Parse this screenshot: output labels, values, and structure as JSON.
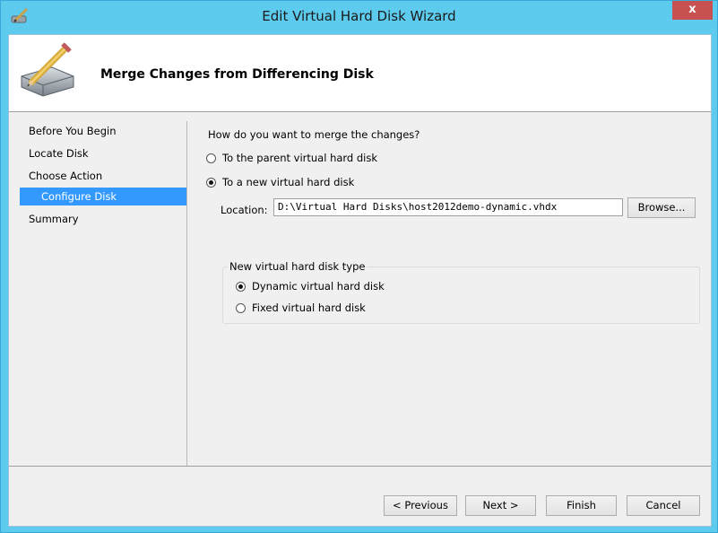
{
  "window": {
    "title": "Edit Virtual Hard Disk Wizard",
    "close_label": "x",
    "accent_color": "#5ccbee"
  },
  "header": {
    "title": "Merge Changes from Differencing Disk",
    "icon": "hard-disk-pencil-icon"
  },
  "nav": {
    "items": [
      {
        "label": "Before You Begin",
        "selected": false
      },
      {
        "label": "Locate Disk",
        "selected": false
      },
      {
        "label": "Choose Action",
        "selected": false
      },
      {
        "label": "Configure Disk",
        "selected": true
      },
      {
        "label": "Summary",
        "selected": false
      }
    ]
  },
  "content": {
    "question": "How do you want to merge the changes?",
    "options": [
      {
        "label": "To the parent virtual hard disk",
        "checked": false
      },
      {
        "label": "To a new virtual hard disk",
        "checked": true
      }
    ],
    "location": {
      "label": "Location:",
      "value": "D:\\Virtual Hard Disks\\host2012demo-dynamic.vhdx",
      "browse_label": "Browse..."
    },
    "disk_type": {
      "legend": "New virtual hard disk type",
      "options": [
        {
          "label": "Dynamic virtual hard disk",
          "checked": true
        },
        {
          "label": "Fixed virtual hard disk",
          "checked": false
        }
      ]
    }
  },
  "footer": {
    "previous_label": "< Previous",
    "next_label": "Next >",
    "finish_label": "Finish",
    "cancel_label": "Cancel"
  }
}
